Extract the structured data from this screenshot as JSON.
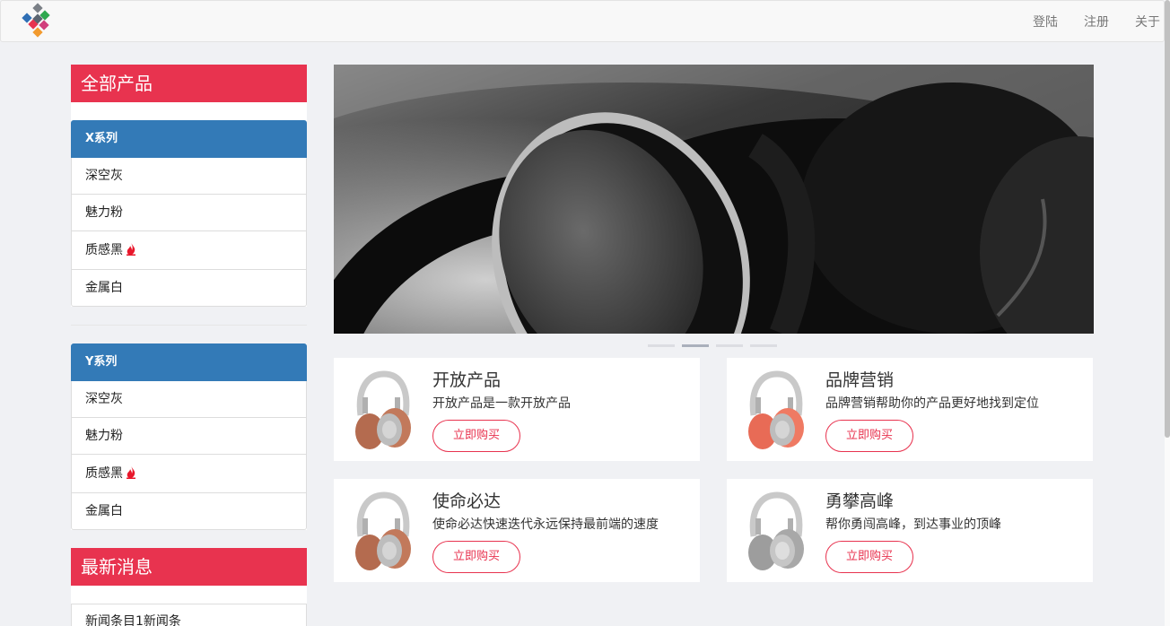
{
  "nav": {
    "login": "登陆",
    "register": "注册",
    "about": "关于"
  },
  "sidebar": {
    "all_products_heading": "全部产品",
    "groups": [
      {
        "title": "X系列",
        "items": [
          {
            "label": "深空灰"
          },
          {
            "label": "魅力粉"
          },
          {
            "label": "质感黑",
            "hot": true
          },
          {
            "label": "金属白"
          }
        ]
      },
      {
        "title": "Y系列",
        "items": [
          {
            "label": "深空灰"
          },
          {
            "label": "魅力粉"
          },
          {
            "label": "质感黑",
            "hot": true
          },
          {
            "label": "金属白"
          }
        ]
      }
    ],
    "news_heading": "最新消息",
    "news_items": [
      "新闻条目1新闻条"
    ]
  },
  "carousel": {
    "slide_count": 4,
    "active_index": 1
  },
  "products": [
    {
      "title": "开放产品",
      "desc": "开放产品是一款开放产品",
      "button": "立即购买",
      "icon": "headphones-brown-icon"
    },
    {
      "title": "品牌营销",
      "desc": "品牌营销帮助你的产品更好地找到定位",
      "button": "立即购买",
      "icon": "headphones-coral-icon"
    },
    {
      "title": "使命必达",
      "desc": "使命必达快速迭代永远保持最前端的速度",
      "button": "立即购买",
      "icon": "headphones-brown-icon"
    },
    {
      "title": "勇攀高峰",
      "desc": "帮你勇闯高峰，到达事业的顶峰",
      "button": "立即购买",
      "icon": "headphones-gray-icon"
    }
  ],
  "colors": {
    "accent_red": "#e8334f",
    "group_blue": "#337ab7",
    "page_bg": "#f0f1f4"
  }
}
